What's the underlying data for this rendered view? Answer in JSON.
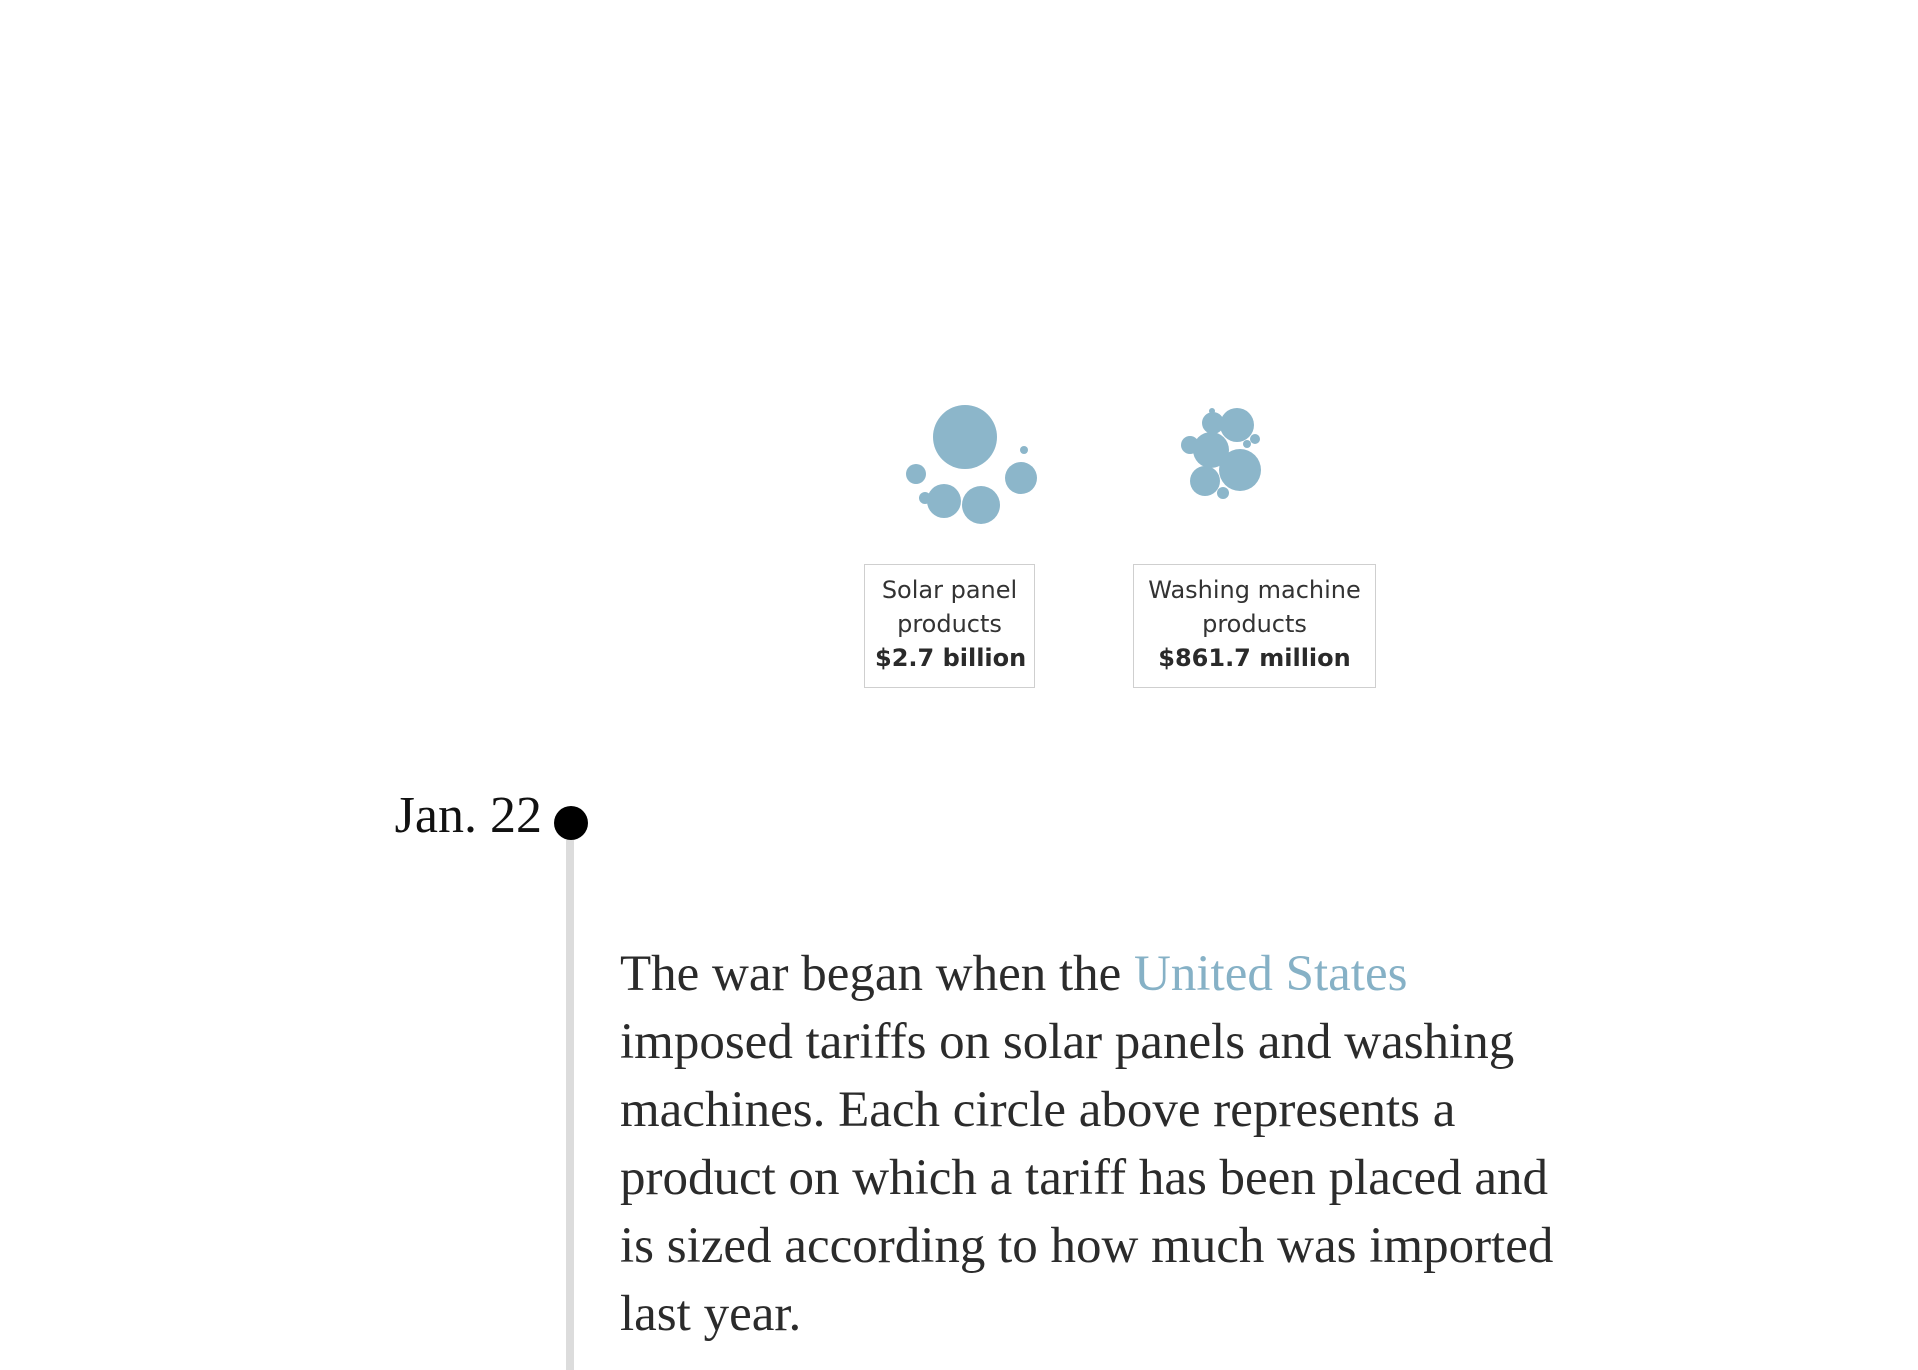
{
  "colors": {
    "bubble": "#8cb6ca",
    "link": "#86b1c6",
    "timeline_line": "#dcdcdc",
    "text": "#2b2b2b"
  },
  "groups": [
    {
      "name_line1": "Solar panel",
      "name_line2": "products",
      "value": "$2.7 billion"
    },
    {
      "name_line1": "Washing machine",
      "name_line2": "products",
      "value": "$861.7 million"
    }
  ],
  "timeline": {
    "date": "Jan. 22"
  },
  "story": {
    "before_link": "The war began when the ",
    "link_text": "United States",
    "after_link": " imposed tariffs on solar panels and washing machines. Each circle above represents a product on which a tariff has been placed and is sized according to how much was imported last year."
  }
}
